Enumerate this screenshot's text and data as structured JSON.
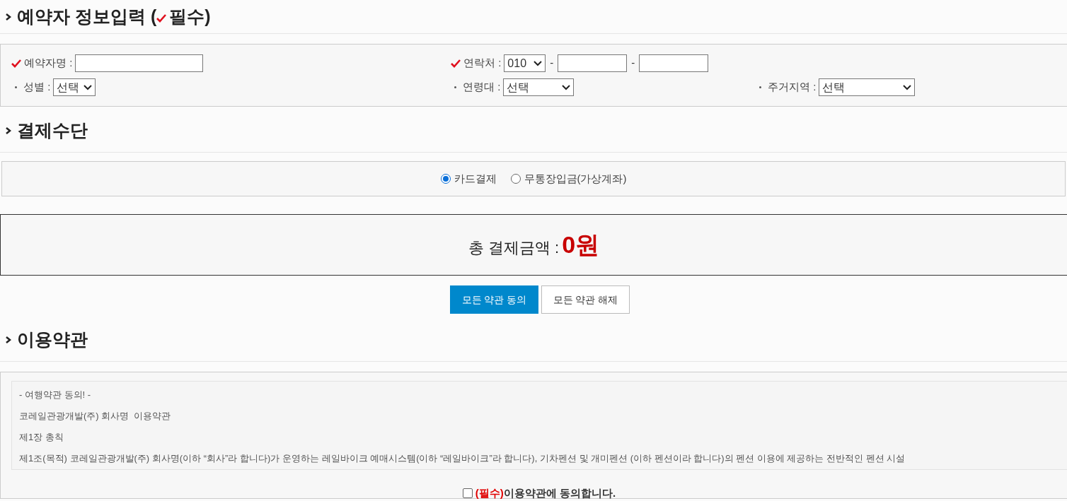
{
  "reservation_section": {
    "title": "예약자 정보입력 (",
    "title_end": "필수)"
  },
  "form_rows": [
    [
      {
        "label": "예약자명 :",
        "required": true,
        "controls": [
          {
            "kind": "text"
          }
        ]
      },
      {
        "label": "연락처 :",
        "required": true,
        "controls": [
          {
            "kind": "select",
            "value": "010"
          },
          {
            "kind": "sep",
            "text": "-"
          },
          {
            "kind": "text"
          },
          {
            "kind": "sep",
            "text": "-"
          },
          {
            "kind": "text"
          }
        ]
      },
      null
    ],
    [
      {
        "label": "성별 :",
        "required": false,
        "controls": [
          {
            "kind": "select",
            "value": "선택"
          }
        ]
      },
      {
        "label": "연령대 :",
        "required": false,
        "controls": [
          {
            "kind": "select",
            "value": "선택"
          }
        ]
      },
      {
        "label": "주거지역 :",
        "required": false,
        "controls": [
          {
            "kind": "select",
            "value": "선택"
          }
        ]
      }
    ]
  ],
  "payment_section": {
    "title": "결제수단"
  },
  "payment_options": [
    {
      "label": "카드결제",
      "selected": true
    },
    {
      "label": "무통장입금(가상계좌)",
      "selected": false
    }
  ],
  "total": {
    "label": "총 결제금액 :",
    "amount": "0원"
  },
  "buttons": [
    {
      "label": "모든 약관 동의",
      "kind": "primary"
    },
    {
      "label": "모든 약관 해제",
      "kind": "secondary"
    }
  ],
  "terms_section": {
    "title": "이용약관"
  },
  "terms_lines": [
    "- 여행약관 동의! -",
    "코레일관광개발(주) 회사명  이용약관",
    "제1장 총칙",
    "제1조(목적) 코레일관광개발(주) 회사명(이하 “회사”라 합니다)가 운영하는 레일바이크 예매시스템(이하 “레일바이크”라 합니다), 기차펜션 및 개미펜션 (이하 펜션이라 합니다)의 펜션 이용에 제공하는 전반적인 펜션 시설"
  ],
  "agree": {
    "checked": false,
    "required_tag": "(필수)",
    "text": "이용약관에 동의합니다."
  }
}
